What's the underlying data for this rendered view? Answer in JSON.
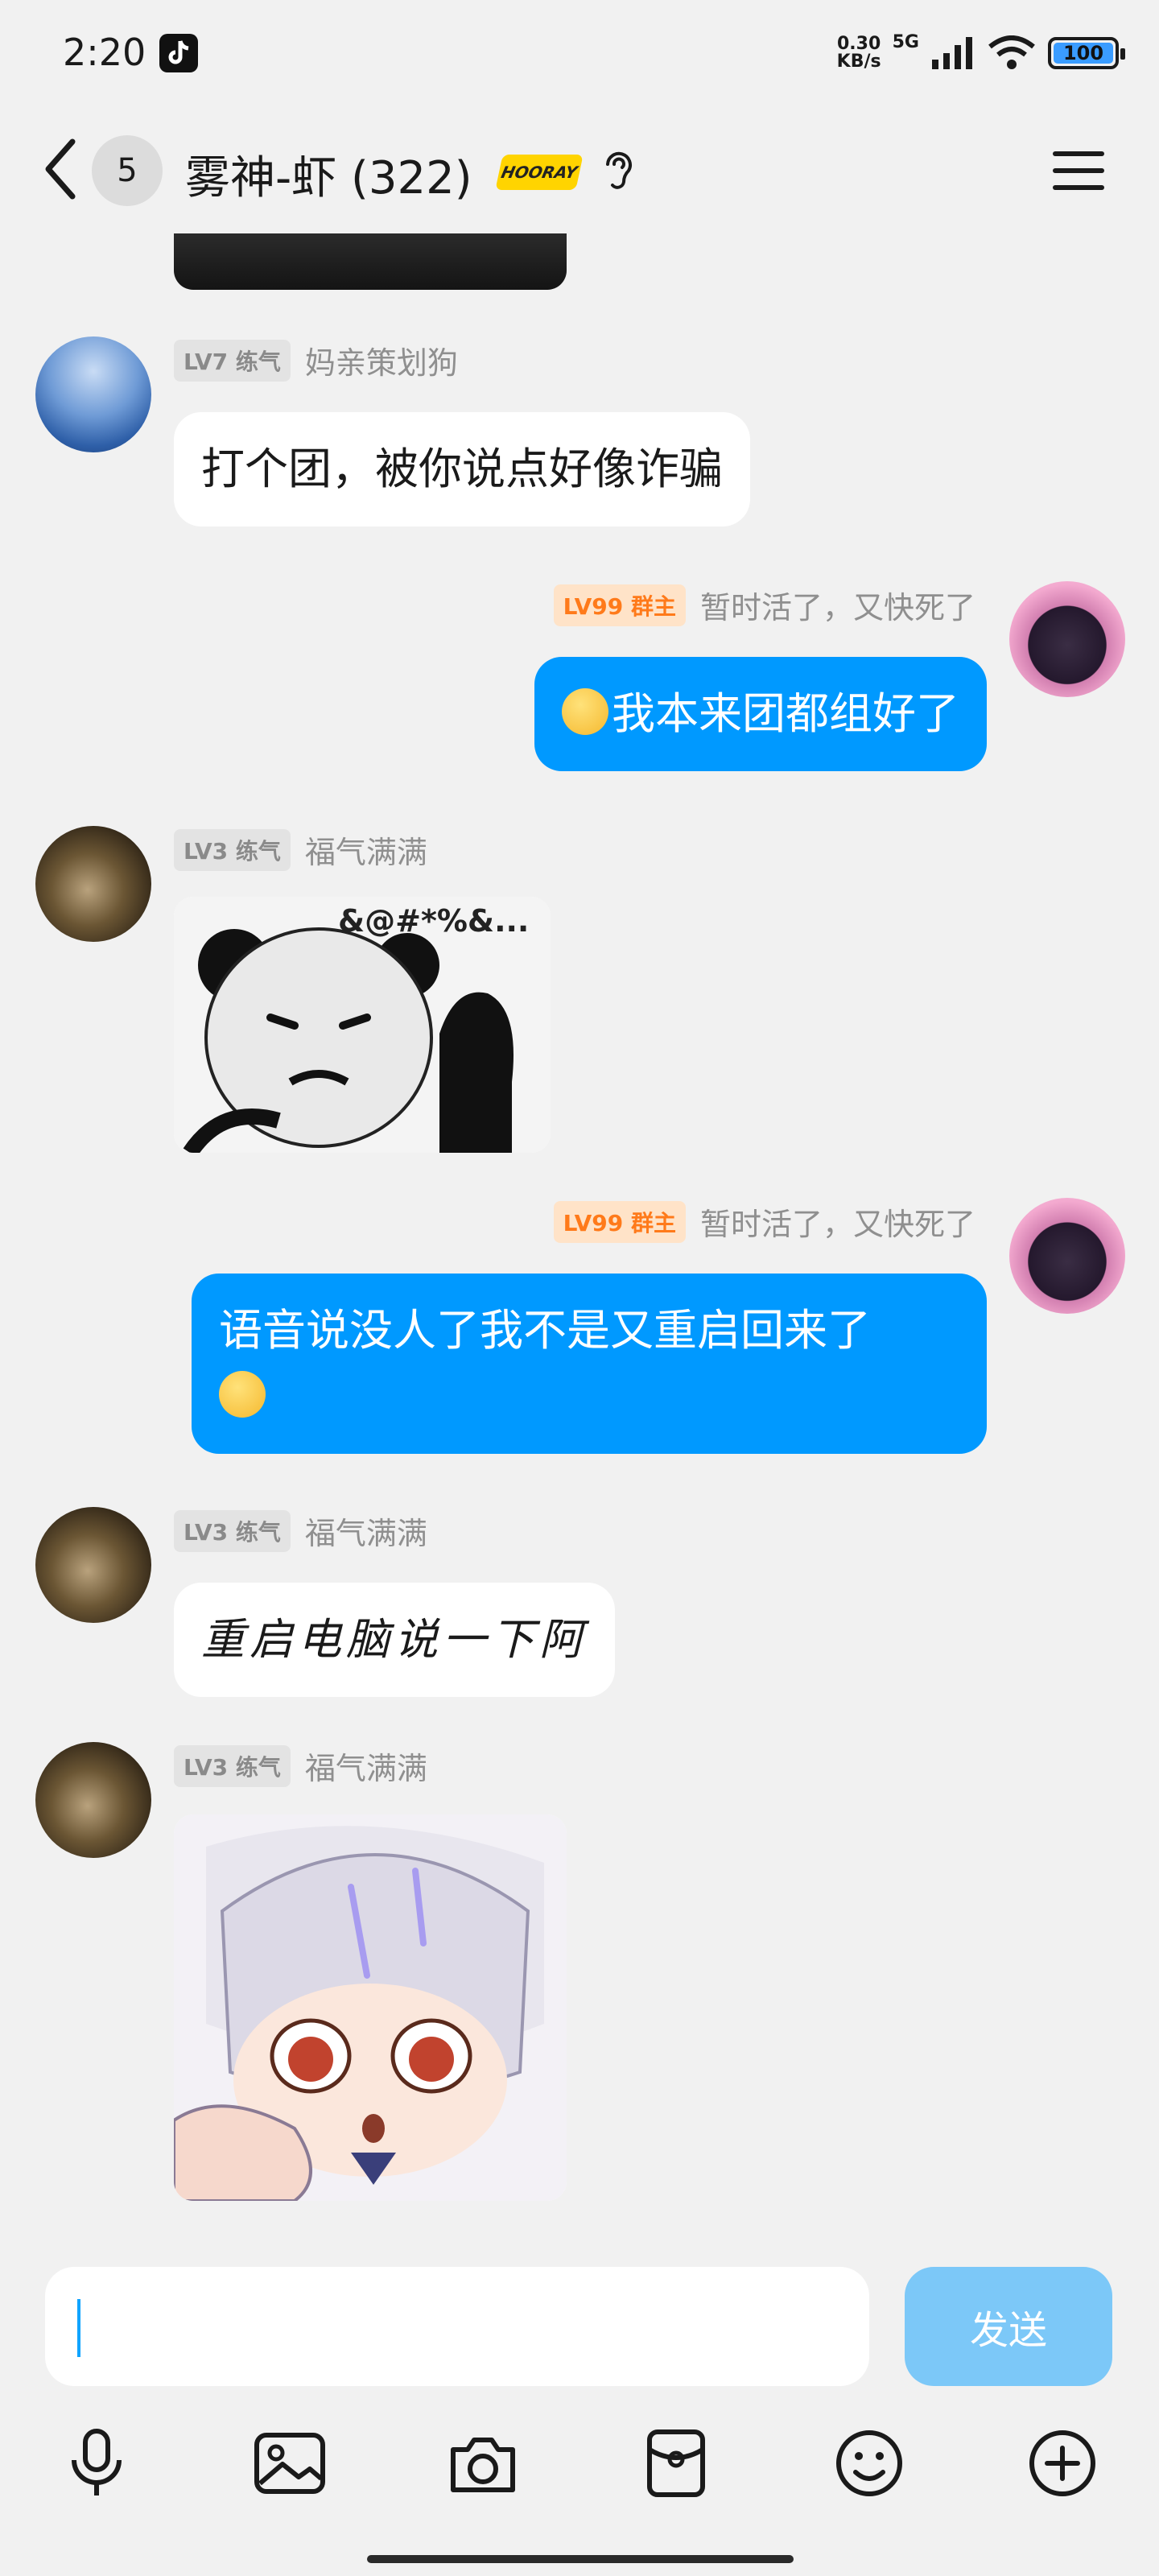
{
  "status_bar": {
    "time": "2:20",
    "net_speed_value": "0.30",
    "net_speed_unit": "KB/s",
    "network": "5G",
    "battery": "100"
  },
  "header": {
    "unread_count": "5",
    "title": "雾神-虾 (322)",
    "badge_text": "HOORAY"
  },
  "messages": [
    {
      "side": "left",
      "level": "LV7 练气",
      "nickname": "妈亲策划狗",
      "text": "打个团，被你说点好像诈骗"
    },
    {
      "side": "right",
      "level": "LV99 群主",
      "nickname": "暂时活了，又快死了",
      "text": "我本来团都组好了"
    },
    {
      "side": "left",
      "level": "LV3 练气",
      "nickname": "福气满满",
      "sticker_text": "&@#*%&..."
    },
    {
      "side": "right",
      "level": "LV99 群主",
      "nickname": "暂时活了，又快死了",
      "text": "语音说没人了我不是又重启回来了"
    },
    {
      "side": "left",
      "level": "LV3 练气",
      "nickname": "福气满满",
      "text": "重启电脑说一下阿"
    },
    {
      "side": "left",
      "level": "LV3 练气",
      "nickname": "福气满满"
    }
  ],
  "input": {
    "value": "",
    "send_label": "发送"
  },
  "toolbar": [
    "mic-icon",
    "image-icon",
    "camera-icon",
    "red-packet-icon",
    "emoji-icon",
    "plus-icon"
  ],
  "colors": {
    "self_bubble": "#0099ff",
    "other_bubble": "#ffffff",
    "background": "#f1f1f1",
    "send_button": "#7cc8f8",
    "owner_tag": "#ff7a1a"
  }
}
